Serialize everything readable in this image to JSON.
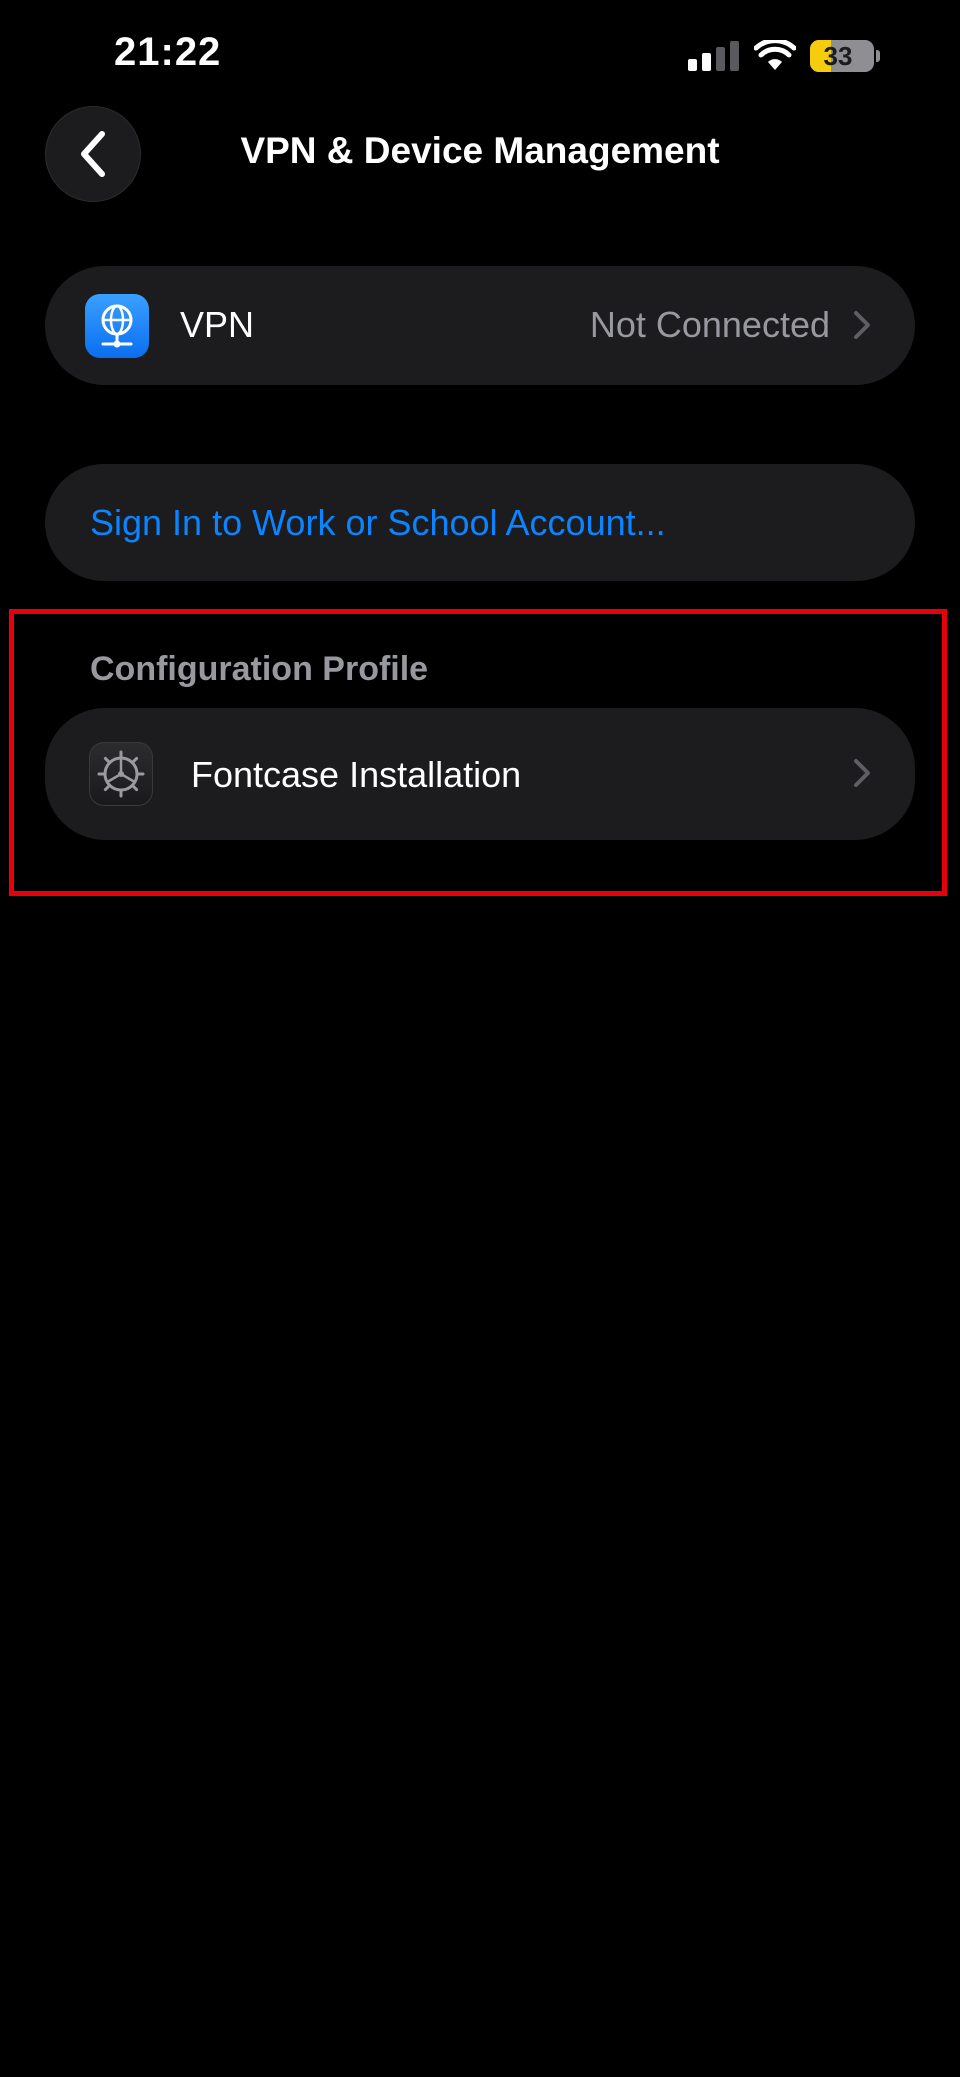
{
  "status_bar": {
    "time": "21:22",
    "battery_level": "33",
    "battery_fraction": 0.33,
    "battery_color": "#f5cd0d"
  },
  "nav": {
    "back_icon": "chevron-left-icon",
    "title": "VPN & Device Management"
  },
  "vpn": {
    "icon": "globe-network-icon",
    "label": "VPN",
    "status": "Not Connected"
  },
  "account": {
    "sign_in_label": "Sign In to Work or School Account..."
  },
  "configuration_profile": {
    "header": "Configuration Profile",
    "items": [
      {
        "icon": "gear-icon",
        "label": "Fontcase Installation"
      }
    ]
  },
  "colors": {
    "background": "#000000",
    "cell": "#1c1c1e",
    "link": "#0a84ff",
    "secondary_text": "#98989f",
    "highlight": "#e5000c"
  }
}
